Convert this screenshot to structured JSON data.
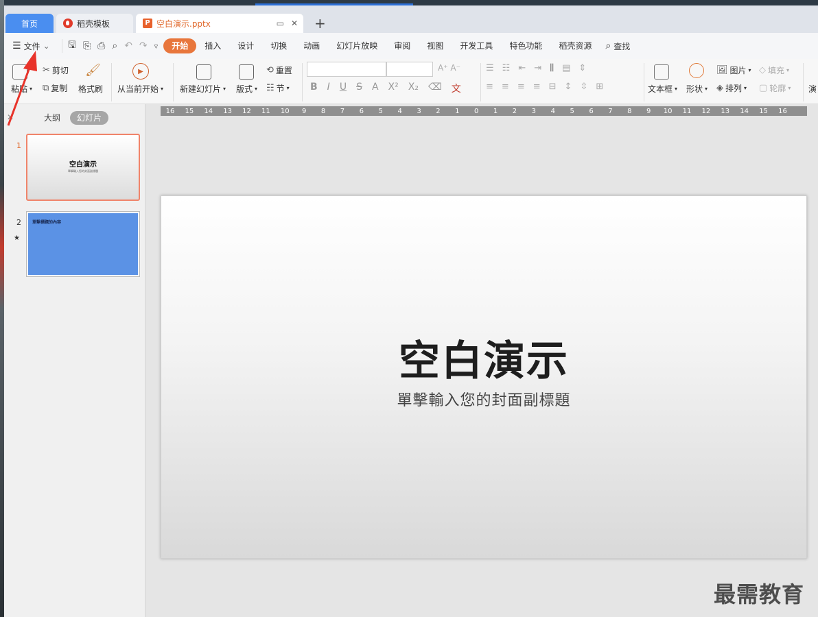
{
  "tabs": {
    "home": "首页",
    "template": "稻壳模板",
    "file": "空白演示.pptx",
    "file_icon_letter": "P"
  },
  "menu": {
    "file": "文件",
    "tabs": [
      "开始",
      "插入",
      "设计",
      "切换",
      "动画",
      "幻灯片放映",
      "审阅",
      "视图",
      "开发工具",
      "特色功能",
      "稻壳资源"
    ],
    "search": "查找"
  },
  "ribbon": {
    "paste": "粘贴",
    "cut": "剪切",
    "copy": "复制",
    "format_painter": "格式刷",
    "from_current": "从当前开始",
    "new_slide": "新建幻灯片",
    "layout": "版式",
    "reset": "重置",
    "section": "节",
    "textbox": "文本框",
    "shape": "形状",
    "picture": "图片",
    "arrange": "排列",
    "fill": "填充",
    "outline": "轮廓",
    "present": "演"
  },
  "left_panel": {
    "outline_tab": "大纲",
    "slides_tab": "幻灯片",
    "slide1_num": "1",
    "slide1_title": "空白演示",
    "slide1_sub": "單擊輸入您的封面副標題",
    "slide2_num": "2",
    "slide2_head": "單擊標題的內容"
  },
  "ruler": [
    "16",
    "15",
    "14",
    "13",
    "12",
    "11",
    "10",
    "9",
    "8",
    "7",
    "6",
    "5",
    "4",
    "3",
    "2",
    "1",
    "0",
    "1",
    "2",
    "3",
    "4",
    "5",
    "6",
    "7",
    "8",
    "9",
    "10",
    "11",
    "12",
    "13",
    "14",
    "15",
    "16"
  ],
  "slide": {
    "title": "空白演示",
    "subtitle": "單擊輸入您的封面副標題"
  },
  "watermark": "最需教育",
  "colors": {
    "accent": "#e8763c",
    "home_tab": "#4a8ef0",
    "slide2_bg": "#5b92e5",
    "arrow": "#e8332a"
  }
}
